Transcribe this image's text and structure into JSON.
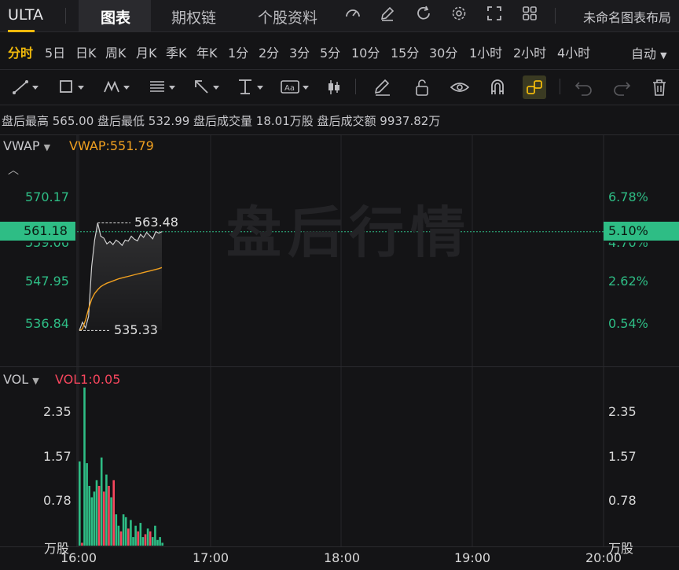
{
  "topbar": {
    "ticker": "ULTA",
    "tabs": [
      "图表",
      "期权链",
      "个股资料"
    ],
    "active_tab": "图表",
    "layout_label": "未命名图表布局"
  },
  "periods": {
    "items": [
      "分时",
      "5日",
      "日K",
      "周K",
      "月K",
      "季K",
      "年K",
      "1分",
      "2分",
      "3分",
      "5分",
      "10分",
      "15分",
      "30分",
      "1小时",
      "2小时",
      "4小时"
    ],
    "active": "分时",
    "auto_label": "自动"
  },
  "info_bar": "盘后最高 565.00 盘后最低 532.99 盘后成交量 18.01万股 盘后成交额 9937.82万",
  "main_pane": {
    "indicator_name": "VWAP",
    "indicator_value": "VWAP:551.79",
    "watermark": "盘后行情",
    "left_ticks": [
      "570.17",
      "547.95",
      "536.84"
    ],
    "right_ticks": [
      "6.78%",
      "2.62%",
      "0.54%"
    ],
    "current_price": "561.18",
    "current_pct": "5.10%",
    "hidden_left_tick": "559.06",
    "hidden_right_tick": "4.70%",
    "high_label": "563.48",
    "low_label": "535.33"
  },
  "vol_pane": {
    "indicator_name": "VOL",
    "indicator_value": "VOL1:0.05",
    "left_ticks": [
      "2.35",
      "1.57",
      "0.78"
    ],
    "right_ticks": [
      "2.35",
      "1.57",
      "0.78"
    ],
    "unit": "万股"
  },
  "time_axis": [
    "16:00",
    "17:00",
    "18:00",
    "19:00",
    "20:00"
  ],
  "colors": {
    "up": "#2ebd85",
    "down": "#f6465d",
    "vwap": "#f0a020",
    "accent": "#f0b90b",
    "price_line": "#d0d0d0"
  },
  "chart_data": [
    {
      "type": "line",
      "x_range": [
        "16:00",
        "20:00"
      ],
      "ylim": [
        532.99,
        570.17
      ],
      "series": [
        {
          "name": "VWAP",
          "values": [
            535.3,
            535.8,
            538,
            541,
            543.5,
            545,
            546,
            546.8,
            547.3,
            547.7,
            548,
            548.3,
            548.6,
            548.9,
            549.1,
            549.3,
            549.5,
            549.7,
            549.9,
            550.1,
            550.3,
            550.5,
            550.7,
            550.9,
            551.1,
            551.3,
            551.5,
            551.79
          ]
        }
      ],
      "price_series": [
        535.33,
        537.5,
        536,
        539,
        552,
        559,
        563.48,
        560,
        559.5,
        558,
        558.6,
        557.8,
        559,
        558.4,
        557.6,
        559,
        558.7,
        560,
        559.2,
        558.8,
        560.5,
        559.7,
        561,
        560.2,
        559.3,
        561.2,
        560.8,
        561.18
      ]
    },
    {
      "type": "bar",
      "ylabel": "万股",
      "ylim": [
        0,
        2.8
      ],
      "values": [
        1.48,
        0.05,
        2.78,
        1.45,
        1.05,
        0.85,
        0.95,
        1.15,
        1.05,
        1.55,
        0.95,
        1.25,
        1.05,
        0.85,
        1.15,
        0.55,
        0.35,
        0.25,
        0.55,
        0.5,
        0.3,
        0.45,
        0.15,
        0.35,
        0.25,
        0.4,
        0.15,
        0.2,
        0.3,
        0.25,
        0.15,
        0.35,
        0.1,
        0.15,
        0.05
      ],
      "colors": [
        "u",
        "d",
        "u",
        "u",
        "u",
        "u",
        "u",
        "u",
        "d",
        "u",
        "d",
        "u",
        "d",
        "u",
        "d",
        "u",
        "u",
        "d",
        "u",
        "u",
        "d",
        "u",
        "u",
        "u",
        "d",
        "u",
        "u",
        "d",
        "u",
        "d",
        "u",
        "u",
        "u",
        "u",
        "u"
      ]
    }
  ]
}
